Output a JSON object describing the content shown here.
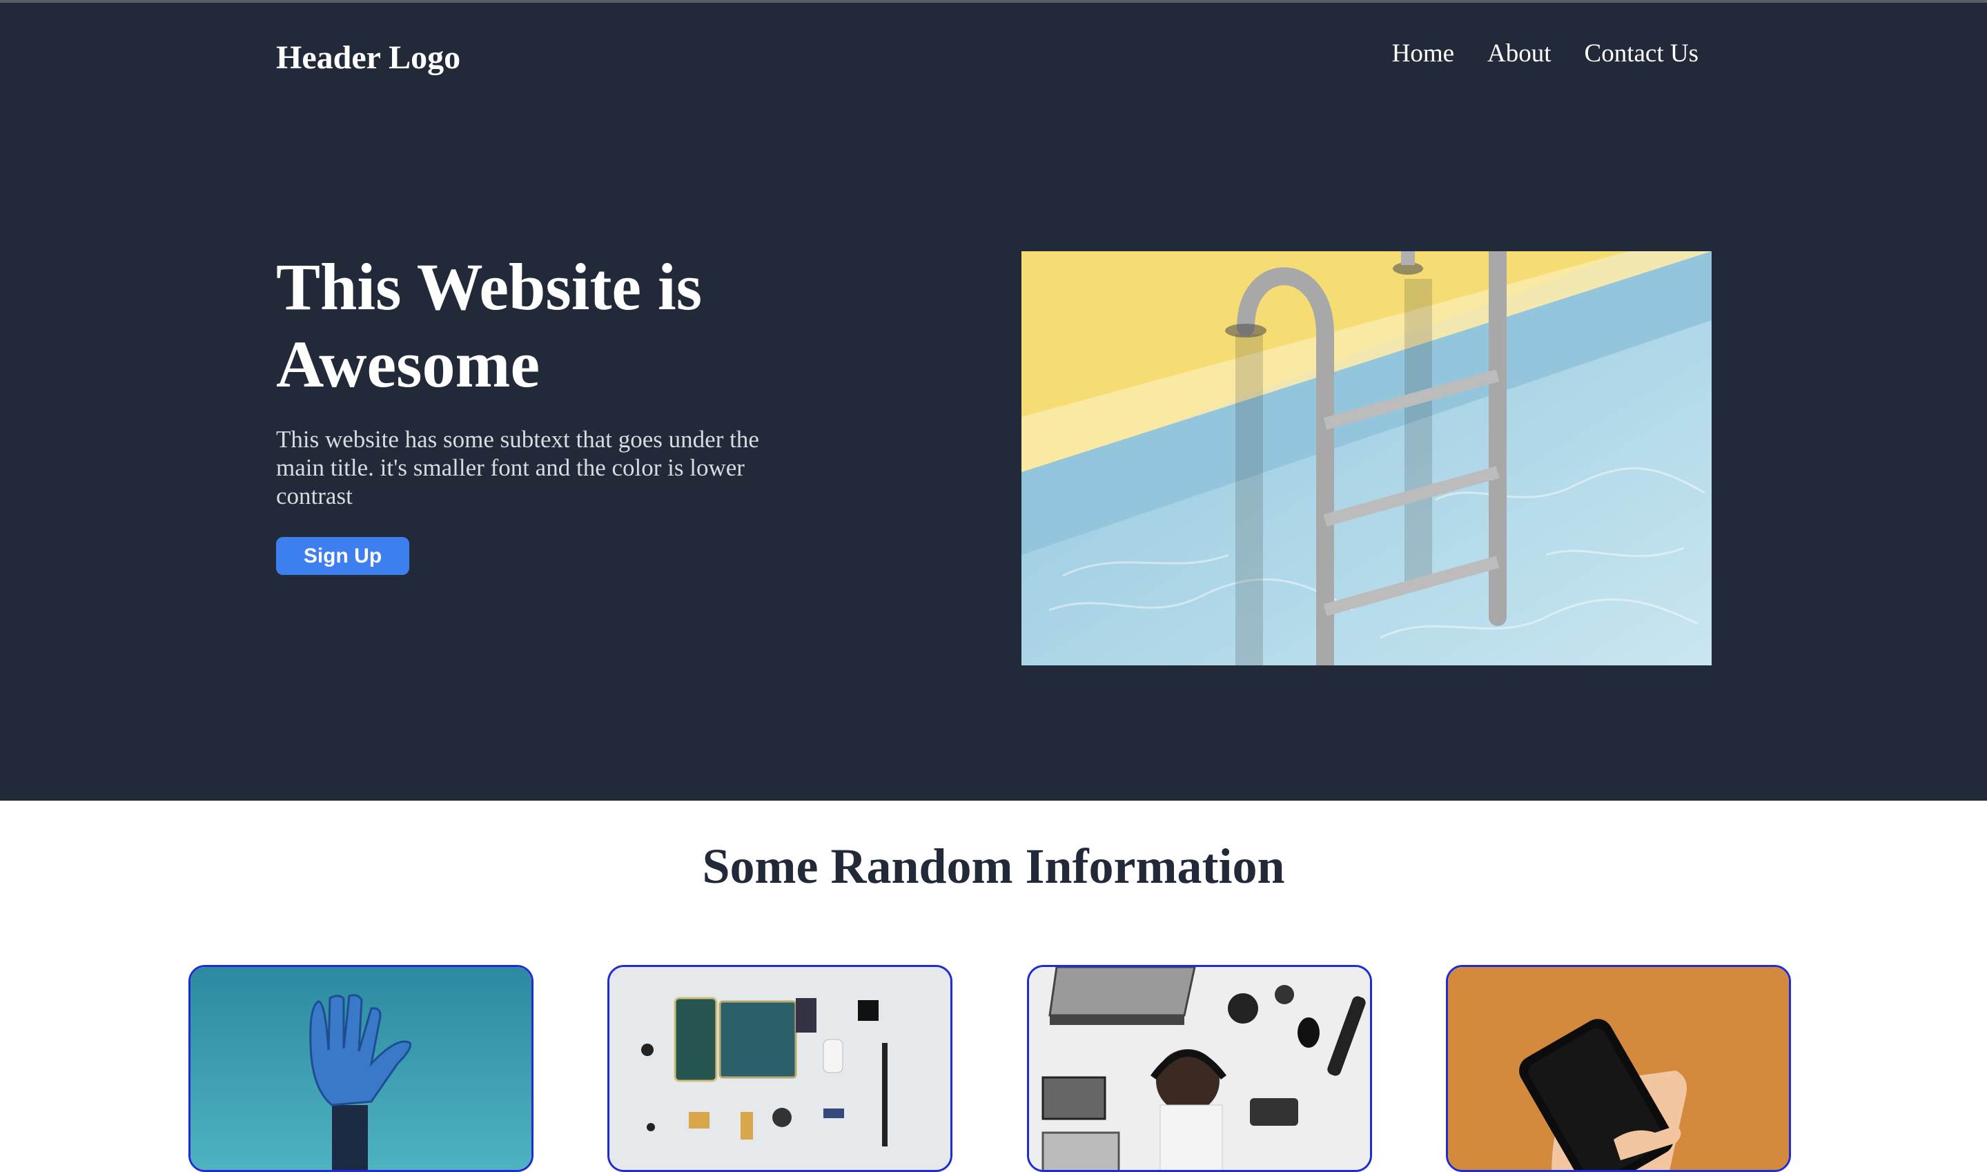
{
  "header": {
    "logo": "Header Logo",
    "nav": [
      {
        "label": "Home"
      },
      {
        "label": "About"
      },
      {
        "label": "Contact Us"
      }
    ]
  },
  "hero": {
    "title": "This Website is Awesome",
    "subtitle": "This website has some subtext that goes under the main title. it's smaller font and the color is lower contrast",
    "cta_label": "Sign Up",
    "image": "pool-ladder-illustration"
  },
  "info": {
    "title": "Some Random Information",
    "cards": [
      {
        "image": "robot-hand-photo"
      },
      {
        "image": "phone-components-photo"
      },
      {
        "image": "desk-with-gadgets-photo"
      },
      {
        "image": "hand-holding-phone-photo"
      }
    ]
  },
  "colors": {
    "hero_background": "#222938",
    "button": "#3d7ff0",
    "card_border": "#1f2cd6",
    "section_title": "#222938"
  }
}
